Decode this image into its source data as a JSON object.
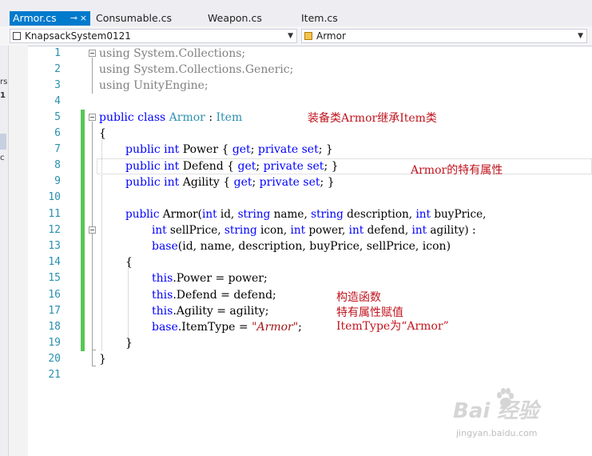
{
  "tabs": [
    {
      "label": "Armor.cs",
      "active": true
    },
    {
      "label": "Consumable.cs"
    },
    {
      "label": "Weapon.cs"
    },
    {
      "label": "Item.cs"
    }
  ],
  "nav": {
    "project_combo": "KnapsackSystem0121",
    "type_combo": "Armor"
  },
  "left_strip": {
    "chars": [
      "rs",
      "1",
      "c"
    ]
  },
  "line_numbers": [
    "1",
    "2",
    "3",
    "4",
    "5",
    "6",
    "7",
    "8",
    "9",
    "10",
    "11",
    "12",
    "13",
    "14",
    "15",
    "16",
    "17",
    "18",
    "19",
    "20",
    "21"
  ],
  "code": {
    "l1_kw": "using",
    "l1_ns": " System.Collections;",
    "l2_kw": "using",
    "l2_ns": " System.Collections.Generic;",
    "l3_kw": "using",
    "l3_ns": " UnityEngine;",
    "l5_kw": "public class ",
    "l5_type": "Armor",
    "l5_colon": " : ",
    "l5_base": "Item",
    "l6": "{",
    "l7_kw1": "public int",
    "l7_name": " Power { ",
    "l7_get": "get",
    "l7_sep": "; ",
    "l7_set": "private set",
    "l7_end": "; }",
    "l8_kw1": "public int",
    "l8_name": " Defend { ",
    "l8_get": "get",
    "l8_sep": "; ",
    "l8_set": "private set",
    "l8_end": "; }",
    "l9_kw1": "public int",
    "l9_name": " Agility { ",
    "l9_get": "get",
    "l9_sep": "; ",
    "l9_set": "private set",
    "l9_end": "; }",
    "l11_a": "public",
    "l11_b": " Armor(",
    "l11_c": "int",
    "l11_d": " id, ",
    "l11_e": "string",
    "l11_f": " name, ",
    "l11_g": "string",
    "l11_h": " description, ",
    "l11_i": "int",
    "l11_j": " buyPrice,",
    "l12_a": "int",
    "l12_b": " sellPrice, ",
    "l12_c": "string",
    "l12_d": " icon, ",
    "l12_e": "int",
    "l12_f": " power, ",
    "l12_g": "int",
    "l12_h": " defend, ",
    "l12_i": "int",
    "l12_j": " agility) :",
    "l13_a": "base",
    "l13_b": "(id, name, description, buyPrice, sellPrice, icon)",
    "l14": "{",
    "l15_a": "this",
    "l15_b": ".Power = power;",
    "l16_a": "this",
    "l16_b": ".Defend = defend;",
    "l17_a": "this",
    "l17_b": ".Agility = agility;",
    "l18_a": "base",
    "l18_b": ".ItemType = ",
    "l18_c": "\"Armor\"",
    "l18_d": ";",
    "l19": "}",
    "l20": "}"
  },
  "annotations": {
    "class_note": "装备类Armor继承Item类",
    "prop_note": "Armor的特有属性",
    "ctor_note1": "构造函数",
    "ctor_note2": "特有属性赋值",
    "ctor_note3": "ItemType为“Armor”"
  },
  "watermark": {
    "logo": "Bai  经验",
    "url": "jingyan.baidu.com"
  },
  "colors": {
    "accent": "#007acc",
    "keyword": "#0000ff",
    "type": "#2b91af",
    "string": "#a31515",
    "annotation": "#c0141e",
    "change_bar": "#57c757"
  }
}
